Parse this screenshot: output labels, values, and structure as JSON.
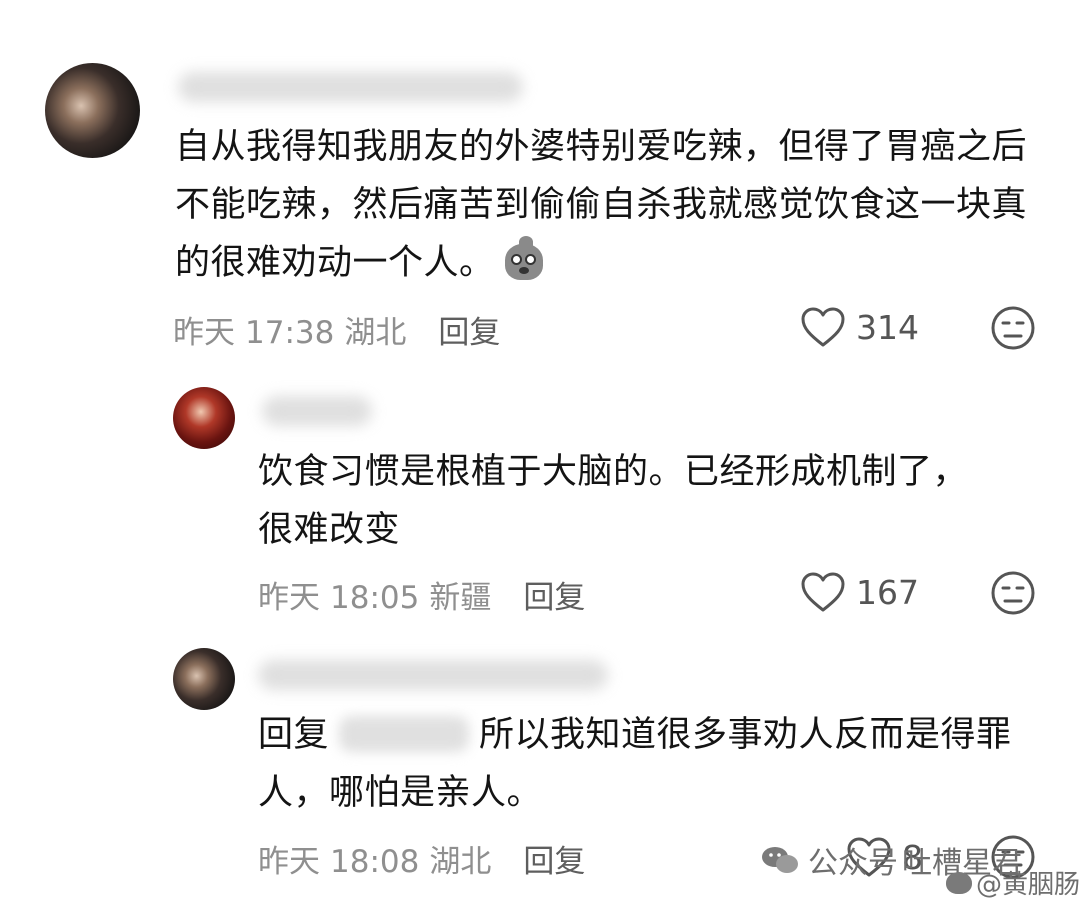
{
  "comments": [
    {
      "text": "自从我得知我朋友的外婆特别爱吃辣，但得了胃癌之后不能吃辣，然后痛苦到偷偷自杀我就感觉饮食这一块真的很难劝动一个人。",
      "emoji": "surprised-bird-emoji",
      "date": "昨天",
      "time": "17:38",
      "location": "湖北",
      "reply_label": "回复",
      "likes": "314"
    },
    {
      "text": "饮食习惯是根植于大脑的。已经形成机制了，很难改变",
      "date": "昨天",
      "time": "18:05",
      "location": "新疆",
      "reply_label": "回复",
      "likes": "167"
    },
    {
      "reply_prefix": "回复",
      "text": "所以我知道很多事劝人反而是得罪人，哪怕是亲人。",
      "date": "昨天",
      "time": "18:08",
      "location": "湖北",
      "reply_label": "回复",
      "likes": "8"
    }
  ],
  "watermark": {
    "wechat_text": "公众号",
    "account": "吐槽星君",
    "weibo_handle": "@黄胭肠"
  },
  "colors": {
    "text": "#141414",
    "meta": "#8f8f8f",
    "icon": "#555555"
  }
}
